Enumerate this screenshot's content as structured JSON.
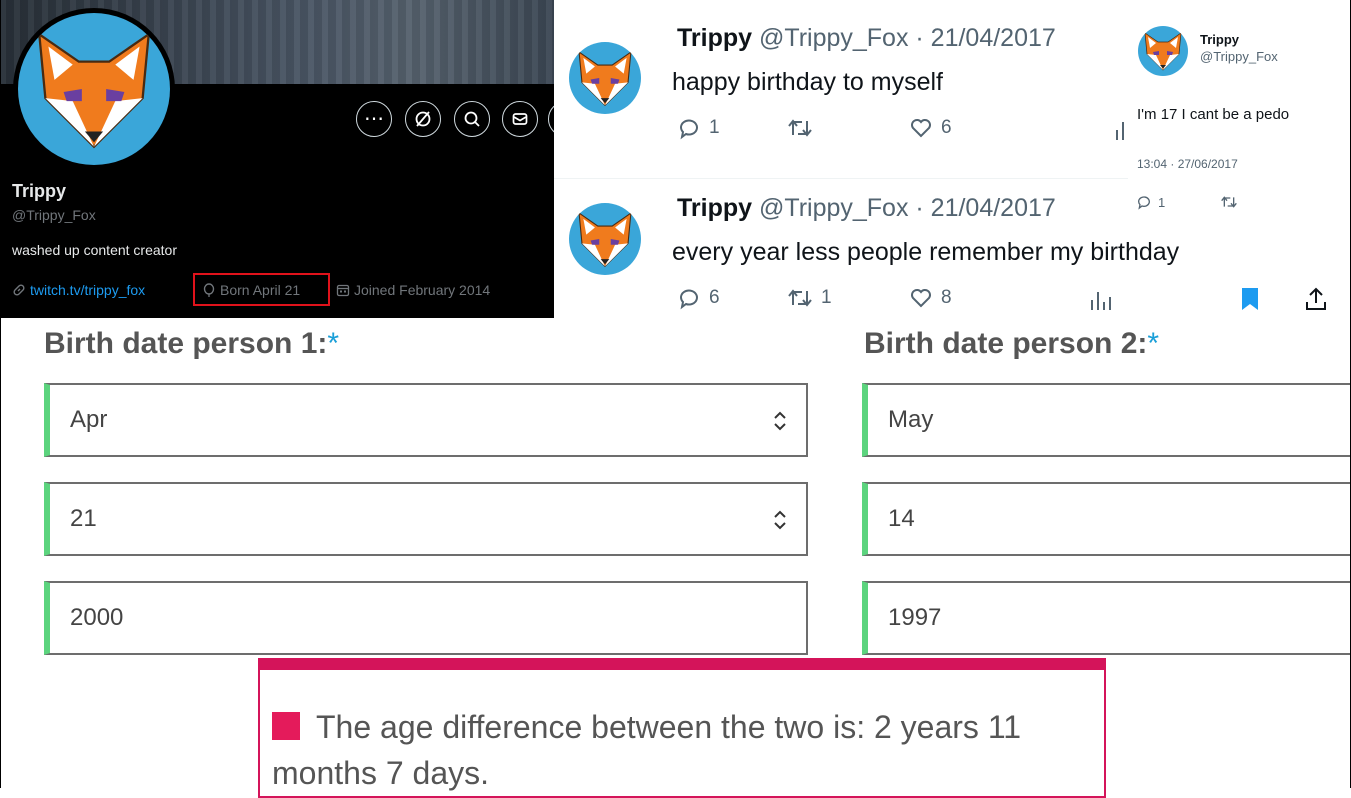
{
  "profile": {
    "name": "Trippy",
    "handle": "@Trippy_Fox",
    "bio": "washed up content creator",
    "link": "twitch.tv/trippy_fox",
    "born": "Born April 21",
    "joined": "Joined February 2014",
    "icons": [
      "more-icon",
      "grok-icon",
      "search-icon",
      "message-icon",
      "link-icon",
      "balloon-icon",
      "calendar-icon"
    ],
    "highlight_color": "#e0121b"
  },
  "tweets": [
    {
      "name": "Trippy",
      "handle_date": "@Trippy_Fox · 21/04/2017",
      "text": "happy birthday to myself",
      "replies": "1",
      "retweets": "",
      "likes": "6"
    },
    {
      "name": "Trippy",
      "handle_date": "@Trippy_Fox · 21/04/2017",
      "text": "every year less people remember my birthday",
      "replies": "6",
      "retweets": "1",
      "likes": "8"
    }
  ],
  "side_tweet": {
    "name": "Trippy",
    "handle": "@Trippy_Fox",
    "text": "I'm 17 I cant be a pedo",
    "timestamp": "13:04 · 27/06/2017",
    "replies": "1"
  },
  "form": {
    "person1": {
      "label": "Birth date person 1:",
      "required": "*",
      "month": "Apr",
      "day": "21",
      "year": "2000"
    },
    "person2": {
      "label": "Birth date person 2:",
      "required": "*",
      "month": "May",
      "day": "14",
      "year": "1997"
    },
    "field_accent": "#5cd47e"
  },
  "result": {
    "text": "The age difference between the two is: 2 years 11 months 7 days.",
    "accent": "#d4145a"
  },
  "colors": {
    "twitter_blue": "#1d9bf0",
    "fox_orange": "#f07b1d",
    "avatar_bg": "#3aa6d9"
  }
}
